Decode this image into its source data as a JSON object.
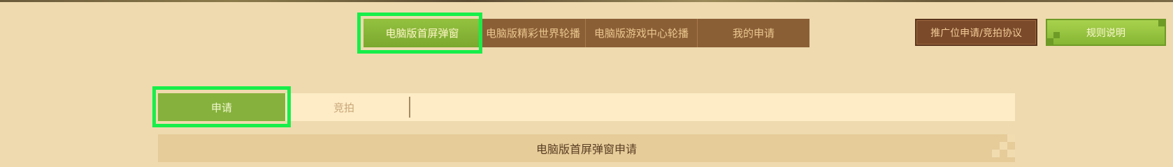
{
  "top_tabs": [
    {
      "label": "电脑版首屏弹窗",
      "active": true
    },
    {
      "label": "电脑版精彩世界轮播",
      "active": false
    },
    {
      "label": "电脑版游戏中心轮播",
      "active": false
    },
    {
      "label": "我的申请",
      "active": false
    }
  ],
  "buttons": {
    "agreement": "推广位申请/竞拍协议",
    "rules": "规则说明"
  },
  "sub_tabs": [
    {
      "label": "申请",
      "active": true
    },
    {
      "label": "竞拍",
      "active": false
    }
  ],
  "section": {
    "title": "电脑版首屏弹窗申请"
  },
  "colors": {
    "active_green": "#85b13c",
    "tab_brown": "#8b5f36",
    "highlight": "#17ee4a",
    "background": "#efdaaf"
  }
}
